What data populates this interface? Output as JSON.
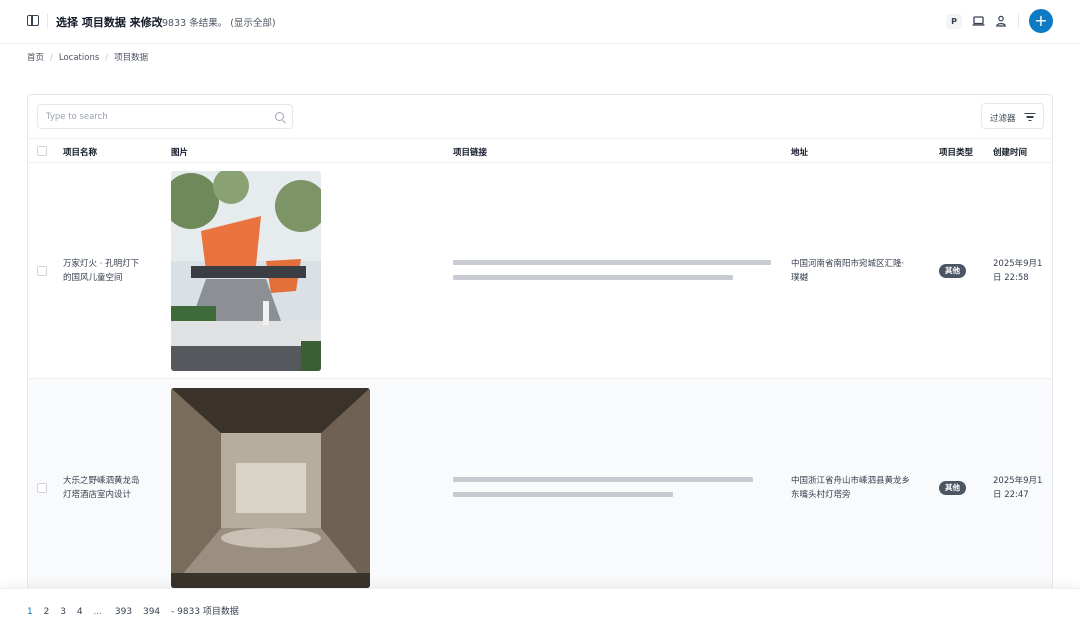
{
  "header": {
    "title": "选择 项目数据 来修改",
    "result_count": "9833 条结果。 (显示全部)",
    "profile_badge": "P",
    "icons": [
      "sidebar-toggle-icon",
      "laptop-icon",
      "user-icon",
      "plus-icon"
    ],
    "add_label": "+",
    "accent_color": "#0e7ac4"
  },
  "breadcrumb": [
    "首页",
    "Locations",
    "项目数据"
  ],
  "search": {
    "placeholder": "Type to search"
  },
  "filter": {
    "label": "过滤器"
  },
  "table": {
    "columns": [
      "项目名称",
      "图片",
      "项目链接",
      "地址",
      "项目类型",
      "创建时间"
    ],
    "rows": [
      {
        "name_line1": "万家灯火 · 孔明灯下",
        "name_line2": "的国风儿童空间",
        "address_line1": "中国河南省南阳市宛城区汇隆·",
        "address_line2": "璞樾",
        "type": "其他",
        "created_line1": "2025年9月1",
        "created_line2": "日 22:58"
      },
      {
        "name_line1": "大乐之野嵊泗黄龙岛",
        "name_line2": "灯塔酒店室内设计",
        "address_line1": "中国浙江省舟山市嵊泗县黄龙乡",
        "address_line2": "东嘴头村灯塔旁",
        "type": "其他",
        "created_line1": "2025年9月1",
        "created_line2": "日 22:47"
      }
    ]
  },
  "pagination": {
    "pages": [
      "1",
      "2",
      "3",
      "4"
    ],
    "ellipsis": "...",
    "last_pages": [
      "393",
      "394"
    ],
    "summary": "- 9833 项目数据",
    "active_page": "1"
  }
}
